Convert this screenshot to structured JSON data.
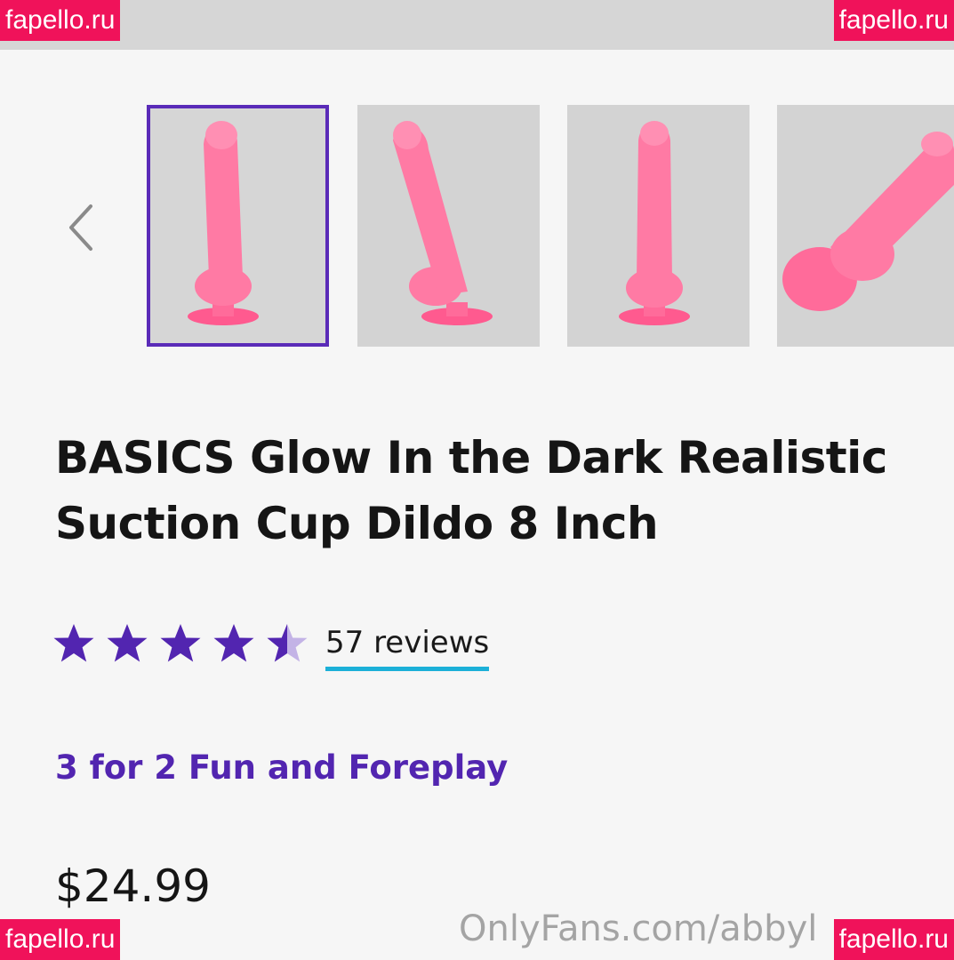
{
  "watermarks": {
    "top_left": "fapello.ru",
    "top_right": "fapello.ru",
    "bottom_left": "fapello.ru",
    "bottom_right": "fapello.ru",
    "onlyfans": "OnlyFans.com/abbyl"
  },
  "gallery": {
    "prev_icon": "chevron-left-icon",
    "selected_index": 0,
    "thumbnail_count": 4
  },
  "product": {
    "title": "BASICS Glow In the Dark Realistic Suction Cup Dildo 8 Inch",
    "rating": 4.5,
    "rating_max": 5,
    "reviews_label": "57 reviews",
    "promo": "3 for 2 Fun and Foreplay",
    "price": "$24.99"
  },
  "colors": {
    "accent_purple": "#5225b0",
    "underline_blue": "#1cb0d8",
    "watermark_red": "#f0125a",
    "product_pink": "#ff6b9a"
  }
}
